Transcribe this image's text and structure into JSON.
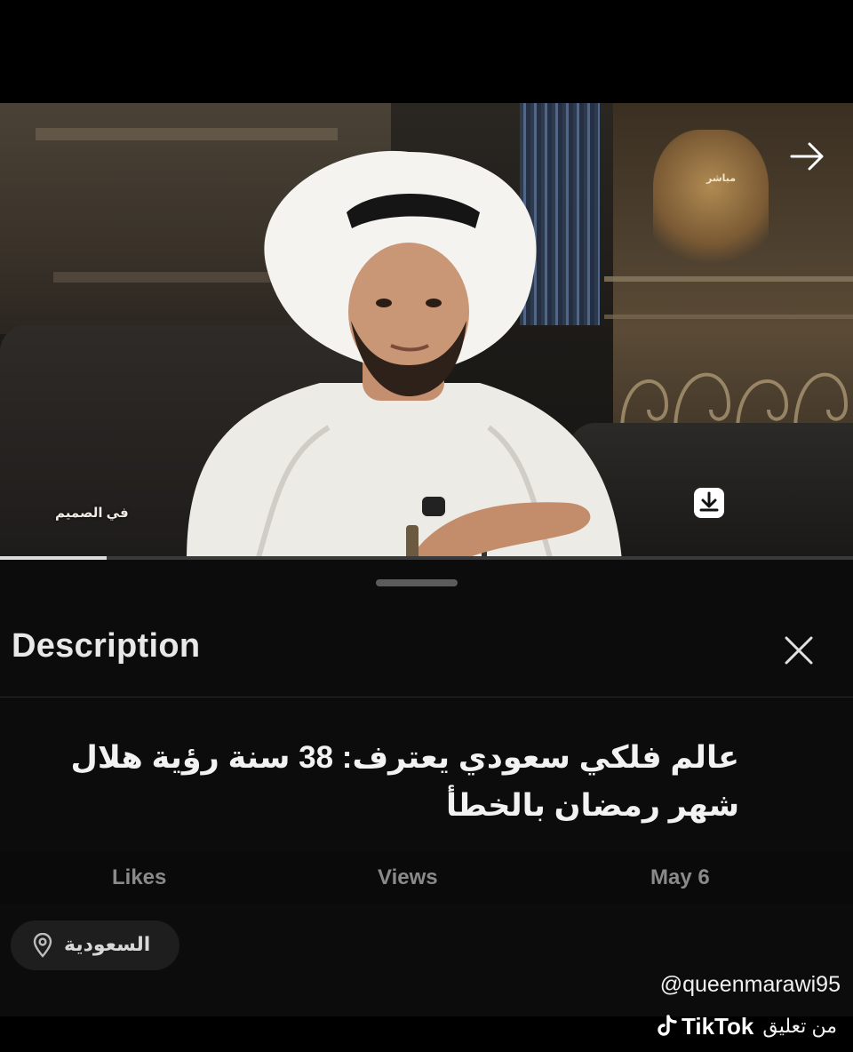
{
  "video": {
    "overlay_logo_text": "في الصميم",
    "live_badge": "مباشر",
    "progress_fraction": 0.125,
    "share_icon": "arrow-right-icon",
    "download_icon": "download-icon"
  },
  "sheet": {
    "title": "Description",
    "close_icon": "close-icon",
    "caption": "عالم فلكي سعودي يعترف: 38 سنة رؤية هلال شهر رمضان بالخطأ",
    "stats": {
      "likes": "Likes",
      "views": "Views",
      "date": "May 6"
    },
    "location": {
      "icon": "location-pin-icon",
      "label": "السعودية"
    }
  },
  "watermark": {
    "handle": "@queenmarawi95",
    "comment_label": "من تعليق",
    "app_name": "TikTok"
  },
  "colors": {
    "background": "#000000",
    "sheet": "#0c0c0c",
    "stat_text": "#8a8a8a",
    "chip": "#1e1e1e"
  }
}
